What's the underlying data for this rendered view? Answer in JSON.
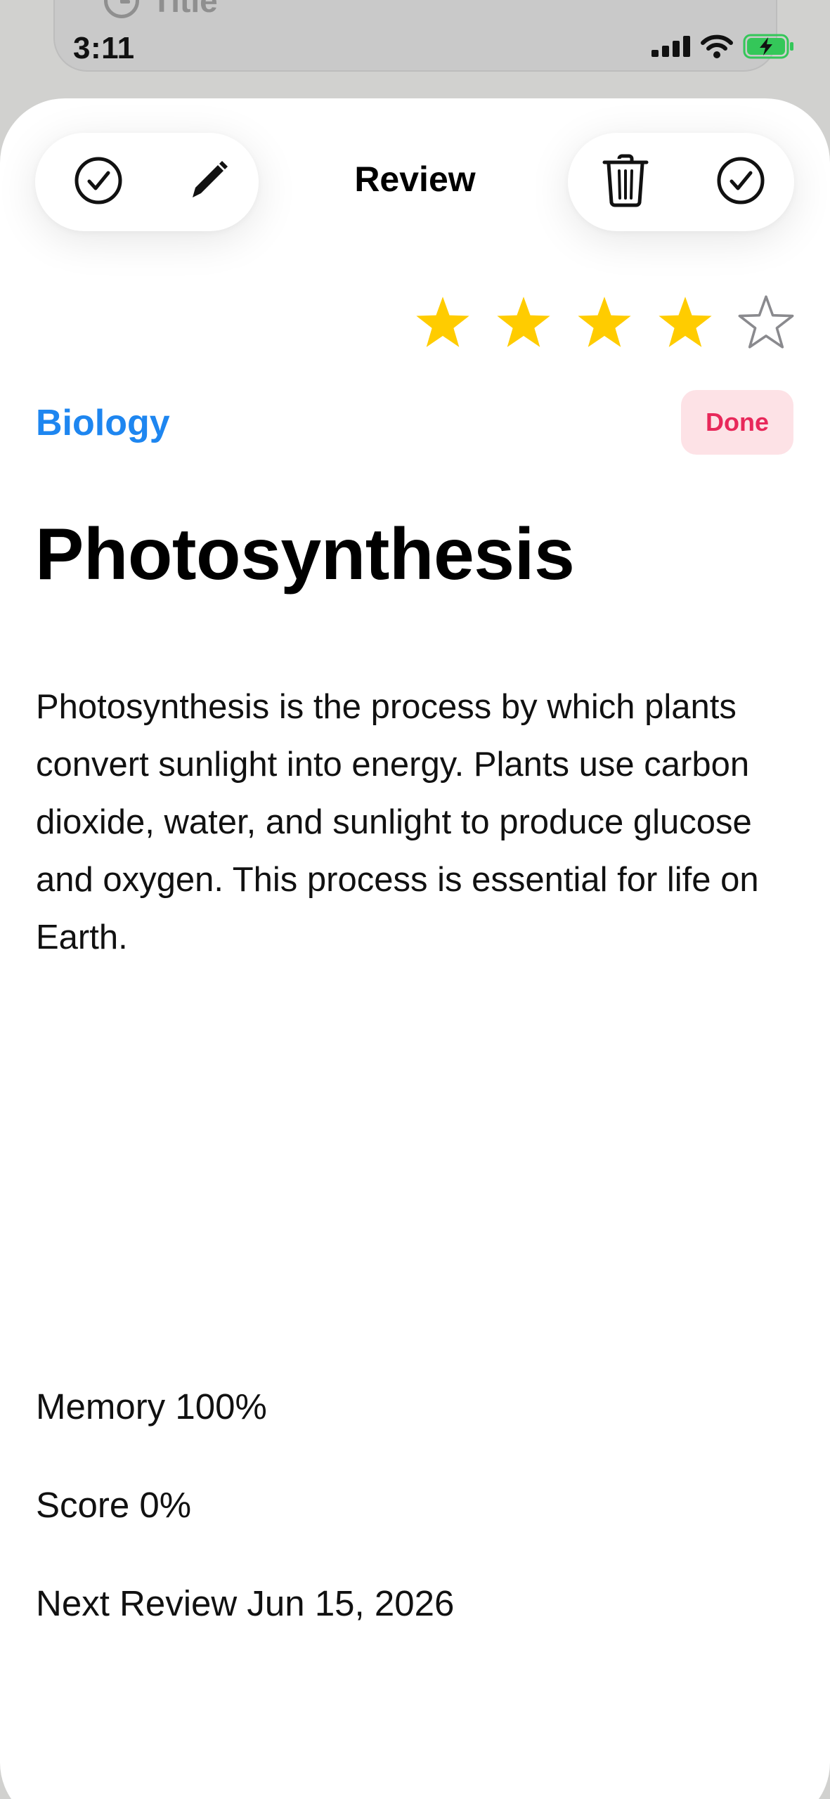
{
  "background": {
    "card_title": "Title"
  },
  "status_bar": {
    "time": "3:11",
    "icons": [
      "cellular-signal-icon",
      "wifi-icon",
      "battery-charging-icon"
    ]
  },
  "toolbar": {
    "title": "Review",
    "left_actions": [
      "checkmark-circle-icon",
      "pencil-icon"
    ],
    "right_actions": [
      "trash-icon",
      "checkmark-circle-icon"
    ]
  },
  "rating": {
    "value": 4,
    "max": 5,
    "filled_color": "#FFCC00",
    "empty_color": "#8A8A8E"
  },
  "card": {
    "category": "Biology",
    "category_color": "#1E86F0",
    "status_badge": "Done",
    "status_color": "#E8285A",
    "title": "Photosynthesis",
    "body": "Photosynthesis is the process by which plants convert sunlight into energy. Plants use carbon dioxide, water, and sunlight to produce glucose and oxygen. This process is essential for life on Earth."
  },
  "stats": {
    "memory": "Memory 100%",
    "score": "Score 0%",
    "next_review": "Next Review Jun 15, 2026"
  }
}
